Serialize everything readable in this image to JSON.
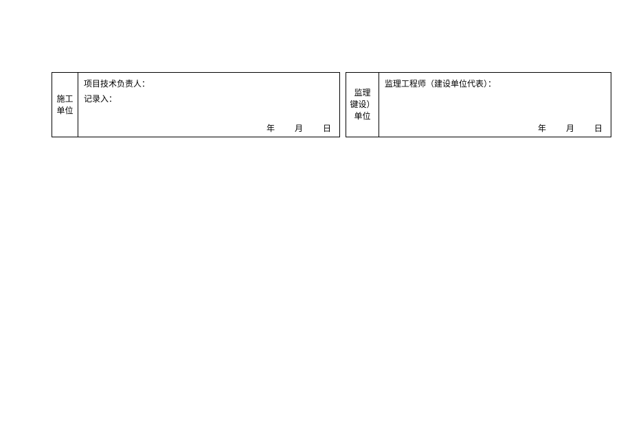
{
  "left": {
    "unit_label": "施工单位",
    "line1": "项目技术负责人：",
    "line2": "记录入：",
    "date_year": "年",
    "date_month": "月",
    "date_day": "日"
  },
  "right": {
    "unit_label": "监理\n键设）单位",
    "line1": "监理工程师（建设单位代表）：",
    "date_year": "年",
    "date_month": "月",
    "date_day": "日"
  }
}
